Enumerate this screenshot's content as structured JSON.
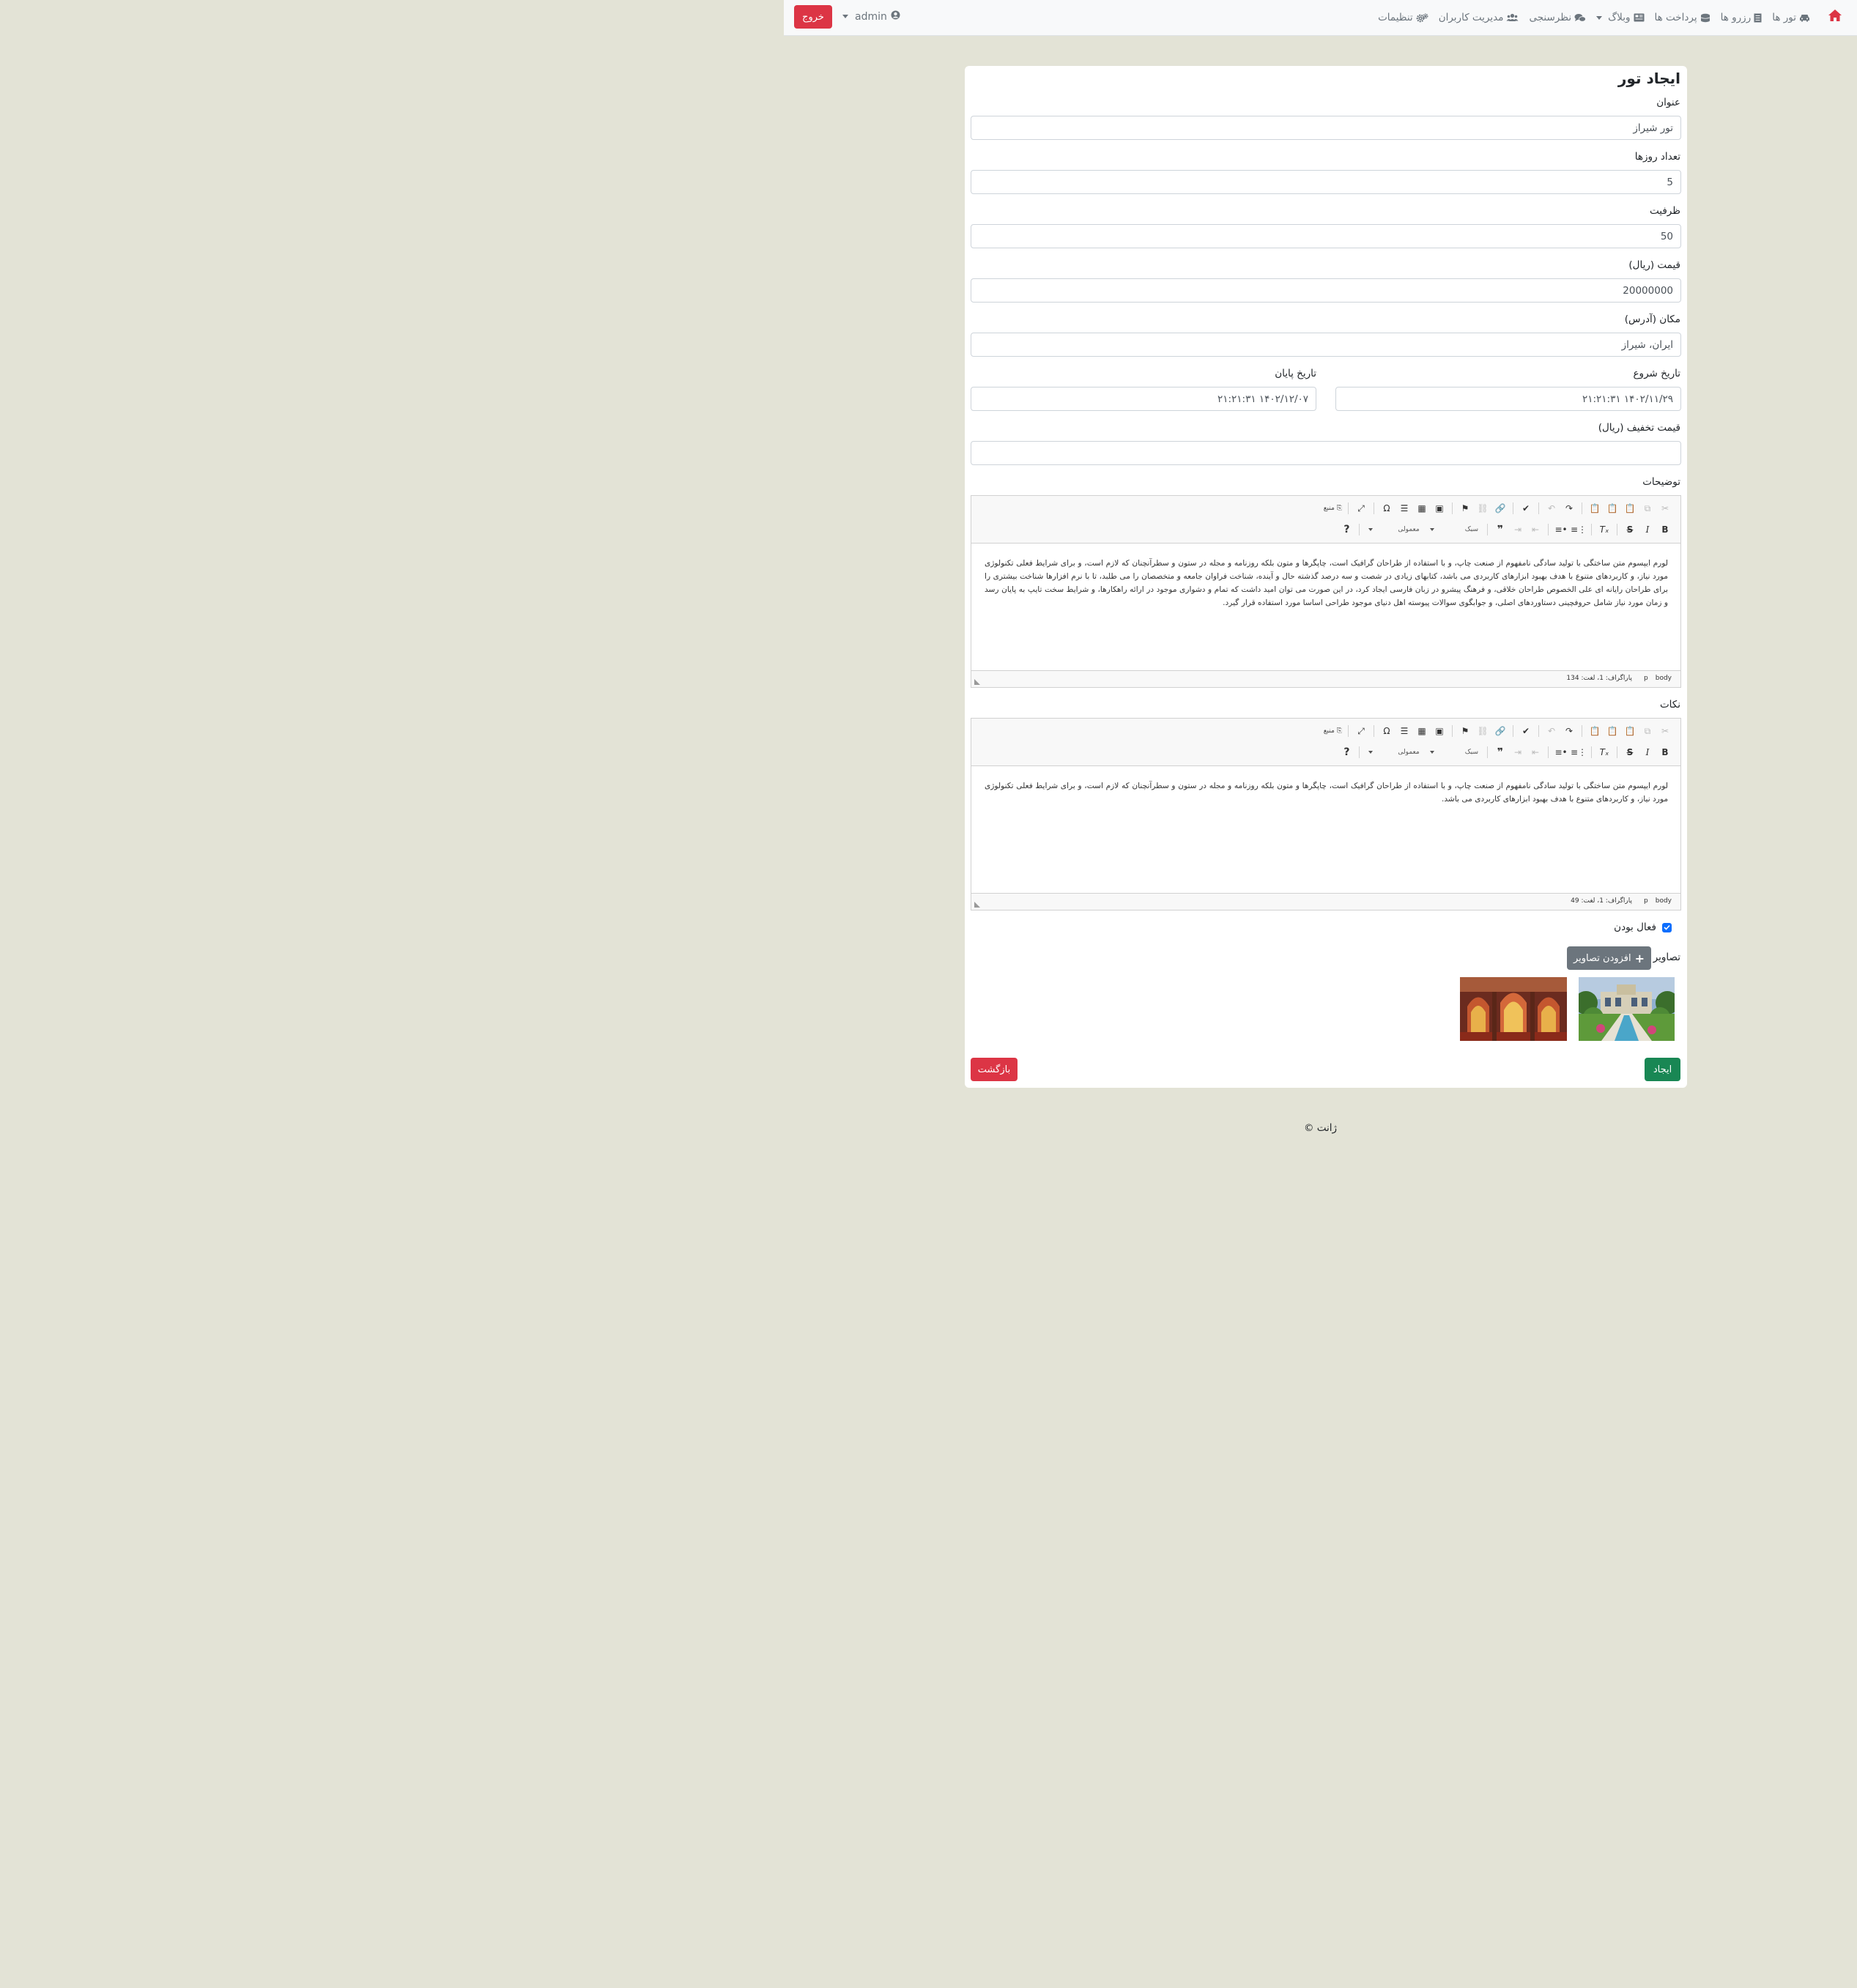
{
  "nav": {
    "home_icon": "home-icon",
    "brand_color": "#dc3545",
    "tours": "تور ها",
    "reservations": "رزرو ها",
    "payments": "پرداخت ها",
    "blog": "وبلاگ",
    "survey": "نظرسنجی",
    "users": "مدیریت کاربران",
    "settings": "تنظیمات",
    "user": "admin",
    "logout": "خروج"
  },
  "form": {
    "title": "ایجاد تور",
    "title_label": "عنوان",
    "title_value": "تور شیراز",
    "days_label": "تعداد روزها",
    "days_value": "5",
    "capacity_label": "ظرفیت",
    "capacity_value": "50",
    "price_label": "قیمت (ریال)",
    "price_value": "20000000",
    "location_label": "مکان (آدرس)",
    "location_value": "ایران، شیراز",
    "start_label": "تاریخ شروع",
    "start_value": "۱۴۰۲/۱۱/۲۹ ۲۱:۲۱:۳۱",
    "end_label": "تاریخ پایان",
    "end_value": "۱۴۰۲/۱۲/۰۷ ۲۱:۲۱:۳۱",
    "discount_label": "قیمت تخفیف (ریال)",
    "discount_value": "",
    "description_label": "توضیحات",
    "notes_label": "نکات",
    "active_label": "فعال بودن",
    "active_checked": true,
    "images_label": "تصاویر",
    "add_images": "افزودن تصاویر",
    "create": "ایجاد",
    "back": "بازگشت"
  },
  "editor_toolbar": {
    "style_label": "سبک",
    "format_label": "معمولی",
    "source_label": "منبع",
    "help_label": "?",
    "blockquote_label": "❞",
    "special_char_label": "Ω"
  },
  "description_editor": {
    "content": "لورم ایپسوم متن ساختگی با تولید سادگی نامفهوم از صنعت چاپ، و با استفاده از طراحان گرافیک است، چاپگرها و متون بلکه روزنامه و مجله در ستون و سطرآنچنان که لازم است، و برای شرایط فعلی تکنولوژی مورد نیاز، و کاربردهای متنوع با هدف بهبود ابزارهای کاربردی می باشد، کتابهای زیادی در شصت و سه درصد گذشته حال و آینده، شناخت فراوان جامعه و متخصصان را می طلبد، تا با نرم افزارها شناخت بیشتری را برای طراحان رایانه ای علی الخصوص طراحان خلاقی، و فرهنگ پیشرو در زبان فارسی ایجاد کرد، در این صورت می توان امید داشت که تمام و دشواری موجود در ارائه راهکارها، و شرایط سخت تایپ به پایان رسد و زمان مورد نیاز شامل حروفچینی دستاوردهای اصلی، و جوابگوی سوالات پیوسته اهل دنیای موجود طراحی اساسا مورد استفاده قرار گیرد.",
    "path_body": "body",
    "path_p": "p",
    "count": "پاراگراف: 1، لغت: 134"
  },
  "notes_editor": {
    "content": "لورم ایپسوم متن ساختگی با تولید سادگی نامفهوم از صنعت چاپ، و با استفاده از طراحان گرافیک است، چاپگرها و متون بلکه روزنامه و مجله در ستون و سطرآنچنان که لازم است، و برای شرایط فعلی تکنولوژی مورد نیاز، و کاربردهای متنوع با هدف بهبود ابزارهای کاربردی می باشد.",
    "path_body": "body",
    "path_p": "p",
    "count": "پاراگراف: 1، لغت: 49"
  },
  "footer": {
    "copyright": "ژانت ©"
  }
}
